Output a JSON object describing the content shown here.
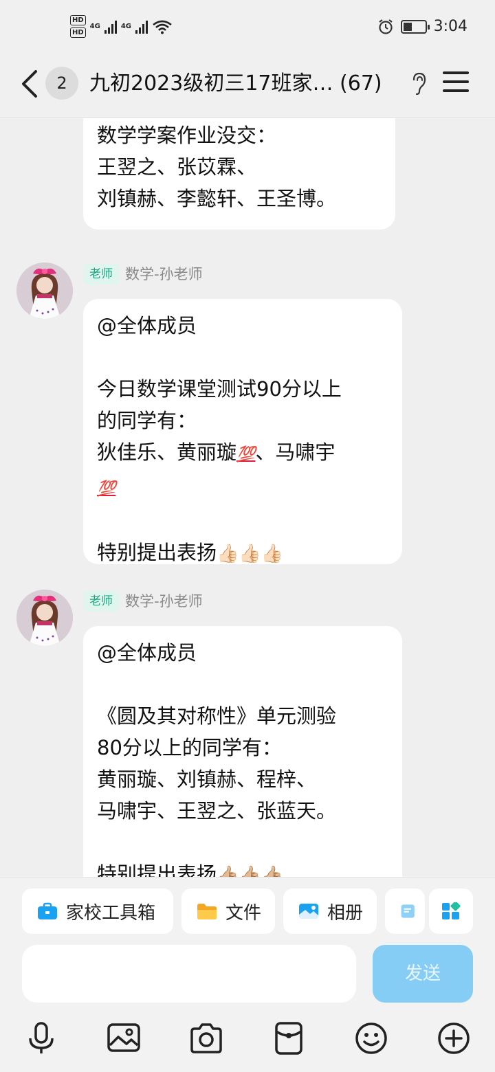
{
  "status_bar": {
    "hd1": "HD",
    "hd2": "HD",
    "net1": "4G",
    "net2": "4G",
    "time": "3:04",
    "battery_level": 0.4
  },
  "header": {
    "unread_count": "2",
    "title": "九初2023级初三17班家…  (67)"
  },
  "messages": [
    {
      "lines": [
        "数学学案作业没交：",
        "王翌之、张苡霖、",
        "刘镇赫、李懿轩、王圣博。"
      ]
    },
    {
      "tag": "老师",
      "sender": "数学-孙老师",
      "line1": "@全体成员",
      "line2": "",
      "line3": "今日数学课堂测试90分以上",
      "line4": "的同学有：",
      "line5_text_a": "狄佳乐、黄丽璇",
      "line5_text_b": "、马啸宇",
      "hundred_emoji": "💯",
      "line7": "",
      "line8_text": "特别提出表扬",
      "thumbs": "👍🏻👍🏻👍🏻"
    },
    {
      "tag": "老师",
      "sender": "数学-孙老师",
      "line1": "@全体成员",
      "line2": "",
      "line3": "《圆及其对称性》单元测验",
      "line4": "80分以上的同学有：",
      "line5": "黄丽璇、刘镇赫、程梓、",
      "line6": "马啸宇、王翌之、张蓝天。",
      "line7": "",
      "line8_text": "特别提出表扬",
      "thumbs": "👍🏼👍🏼👍🏼"
    }
  ],
  "toolbar": {
    "chips": [
      "家校工具箱",
      "文件",
      "相册"
    ],
    "send_label": "发送",
    "colors": {
      "accent": "#1aa1f1",
      "send_bg": "#86cdf5",
      "tag_text": "#19a780",
      "tag_bg": "#dff5ee"
    }
  }
}
